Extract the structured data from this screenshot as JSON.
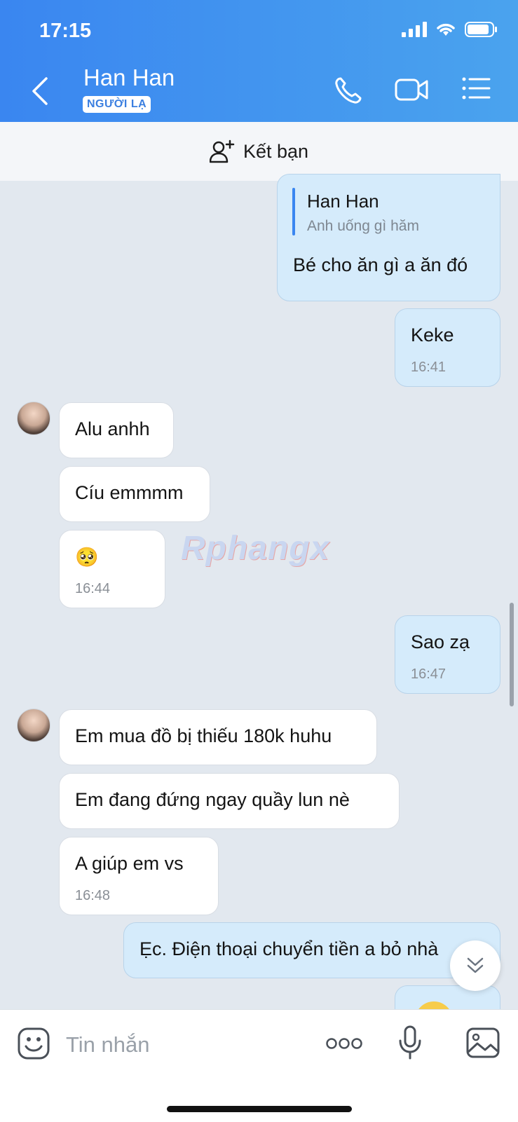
{
  "status_bar": {
    "time": "17:15"
  },
  "header": {
    "contact_name": "Han Han",
    "badge": "NGƯỜI LẠ"
  },
  "add_friend": {
    "label": "Kết bạn"
  },
  "messages": {
    "quote": {
      "author": "Han Han",
      "text": "Anh uống gì hăm",
      "reply": "Bé cho ăn gì a ăn đó"
    },
    "m1": {
      "text": "Keke",
      "time": "16:41"
    },
    "m2": {
      "text": "Alu anhh"
    },
    "m3": {
      "text": "Cíu emmmm"
    },
    "m4": {
      "text": "🥺",
      "time": "16:44"
    },
    "m5": {
      "text": "Sao zạ",
      "time": "16:47"
    },
    "m6": {
      "text": "Em mua đồ bị thiếu 180k huhu"
    },
    "m7": {
      "text": "Em đang đứng ngay quầy lun nè"
    },
    "m8": {
      "text": "A giúp em vs",
      "time": "16:48"
    },
    "m9": {
      "text": "Ẹc. Điện thoại chuyển tiền a bỏ nhà"
    }
  },
  "watermark": "Rphangx",
  "input": {
    "placeholder": "Tin nhắn"
  },
  "colors": {
    "header_start": "#3a86f0",
    "header_end": "#4aa3ee",
    "outgoing_bubble": "#d5ebfb",
    "incoming_bubble": "#ffffff"
  },
  "icons": [
    "back-icon",
    "phone-icon",
    "video-icon",
    "menu-list-icon",
    "add-user-icon",
    "sticker-icon",
    "more-icon",
    "mic-icon",
    "image-icon",
    "chevron-down-double-icon"
  ]
}
